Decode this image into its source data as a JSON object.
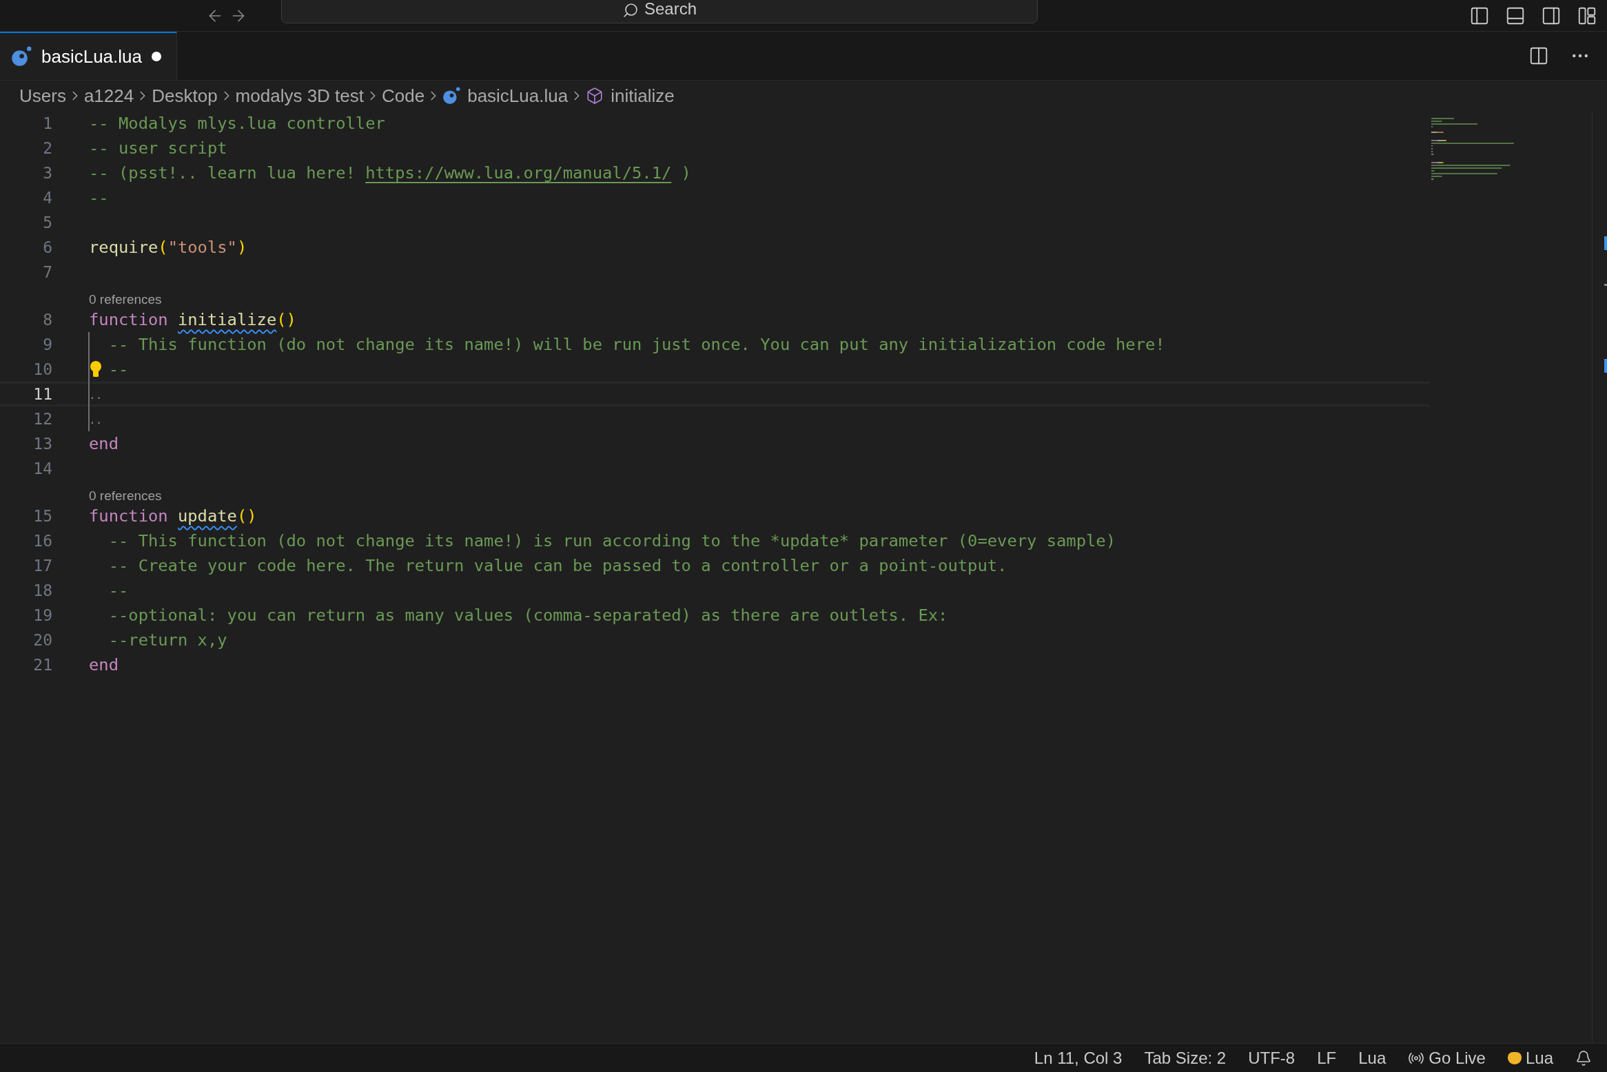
{
  "title_bar": {
    "search": "Search"
  },
  "tabs": [
    {
      "label": "basicLua.lua",
      "selected": true,
      "modified": true
    }
  ],
  "breadcrumbs": [
    {
      "label": "Users",
      "kind": "folder"
    },
    {
      "label": "a1224",
      "kind": "folder"
    },
    {
      "label": "Desktop",
      "kind": "folder"
    },
    {
      "label": "modalys 3D test",
      "kind": "folder"
    },
    {
      "label": "Code",
      "kind": "folder"
    },
    {
      "label": "basicLua.lua",
      "kind": "file"
    },
    {
      "label": "initialize",
      "kind": "symbol"
    }
  ],
  "editor": {
    "lines": [
      {
        "number": "1",
        "current": false,
        "tokens": [
          {
            "kind": "comment",
            "text": "-- Modalys mlys.lua controller"
          }
        ]
      },
      {
        "number": "2",
        "current": false,
        "tokens": [
          {
            "kind": "comment",
            "text": "-- user script"
          }
        ]
      },
      {
        "number": "3",
        "current": false,
        "tokens": [
          {
            "kind": "comment",
            "text": "-- (psst!.. learn lua here! "
          },
          {
            "kind": "link",
            "text": "https://www.lua.org/manual/5.1/"
          },
          {
            "kind": "comment",
            "text": " )"
          }
        ]
      },
      {
        "number": "4",
        "current": false,
        "tokens": [
          {
            "kind": "comment",
            "text": "--"
          }
        ]
      },
      {
        "number": "5",
        "current": false
      },
      {
        "number": "6",
        "current": false,
        "tokens": [
          {
            "kind": "function",
            "text": "require"
          },
          {
            "kind": "bracket",
            "text": "("
          },
          {
            "kind": "string",
            "text": "\"tools\""
          },
          {
            "kind": "bracket",
            "text": ")"
          }
        ]
      },
      {
        "number": "7",
        "current": false
      },
      {
        "number": "8",
        "current": false,
        "lens": "0 references",
        "tokens": [
          {
            "kind": "keyword",
            "text": "function"
          },
          {
            "kind": "warning",
            "text": "initialize"
          },
          {
            "kind": "bracket",
            "text": "()"
          }
        ]
      },
      {
        "number": "9",
        "current": false,
        "guide": true,
        "tokens": [
          {
            "kind": "comment",
            "text": "  -- This function (do not change its name!) will be run just once. You can put any initialization code here!"
          }
        ]
      },
      {
        "number": "10",
        "current": false,
        "guide": true,
        "lightbulb": true,
        "tokens": [
          {
            "kind": "comment",
            "text": "--"
          }
        ]
      },
      {
        "number": "11",
        "current": true,
        "guide": true,
        "tokens": [
          {
            "kind": "whitespace",
            "text": "··"
          }
        ]
      },
      {
        "number": "12",
        "current": false,
        "guide": true,
        "tokens": [
          {
            "kind": "whitespace",
            "text": "··"
          }
        ]
      },
      {
        "number": "13",
        "current": false,
        "tokens": [
          {
            "kind": "keyword",
            "text": "end"
          }
        ]
      },
      {
        "number": "14",
        "current": false
      },
      {
        "number": "15",
        "current": false,
        "lens": "0 references",
        "tokens": [
          {
            "kind": "keyword",
            "text": "function"
          },
          {
            "kind": "warning",
            "text": "update"
          },
          {
            "kind": "bracket",
            "text": "()"
          }
        ]
      },
      {
        "number": "16",
        "current": false,
        "tokens": [
          {
            "kind": "comment",
            "text": "  -- This function (do not change its name!) is run according to the *update* parameter (0=every sample)"
          }
        ]
      },
      {
        "number": "17",
        "current": false,
        "tokens": [
          {
            "kind": "comment",
            "text": "  -- Create your code here. The return value can be passed to a controller or a point-output."
          }
        ]
      },
      {
        "number": "18",
        "current": false,
        "tokens": [
          {
            "kind": "comment",
            "text": "  --"
          }
        ]
      },
      {
        "number": "19",
        "current": false,
        "tokens": [
          {
            "kind": "comment",
            "text": "  --optional: you can return as many values (comma-separated) as there are outlets. Ex:"
          }
        ]
      },
      {
        "number": "20",
        "current": false,
        "tokens": [
          {
            "kind": "comment",
            "text": "  --return x,y"
          }
        ]
      },
      {
        "number": "21",
        "current": false,
        "tokens": [
          {
            "kind": "keyword",
            "text": "end"
          }
        ]
      }
    ]
  },
  "status_bar": {
    "items": [
      {
        "kind": "text",
        "text": "Ln 11, Col 3"
      },
      {
        "kind": "text",
        "text": "Tab Size: 2"
      },
      {
        "kind": "text",
        "text": "UTF-8"
      },
      {
        "kind": "text",
        "text": "LF"
      },
      {
        "kind": "text",
        "text": "Lua"
      },
      {
        "kind": "broadcast",
        "text": "Go Live"
      },
      {
        "kind": "cat",
        "text": "Lua"
      }
    ]
  }
}
